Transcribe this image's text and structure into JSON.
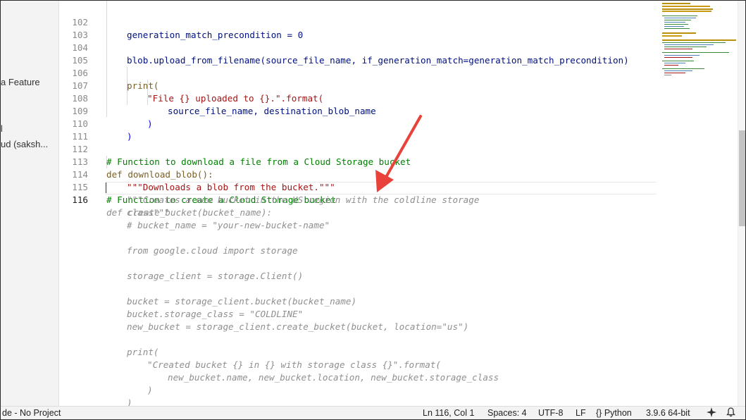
{
  "sidebar": {
    "items": [
      {
        "label": "a Feature"
      },
      {
        "label": "l"
      },
      {
        "label": "ud (saksh..."
      }
    ]
  },
  "editor": {
    "lines": [
      {
        "num": "102",
        "code": "generation_match_precondition = 0"
      },
      {
        "num": "103",
        "code": ""
      },
      {
        "num": "104",
        "code": "blob.upload_from_filename(source_file_name, if_generation_match=generation_match_precondition)"
      },
      {
        "num": "105",
        "code": ""
      },
      {
        "num": "106",
        "code": "print("
      },
      {
        "num": "107",
        "code": "\"File {} uploaded to {}.\".format("
      },
      {
        "num": "108",
        "code": "source_file_name, destination_blob_name"
      },
      {
        "num": "109",
        "code": ")"
      },
      {
        "num": "110",
        "code": ")"
      },
      {
        "num": "111",
        "code": ""
      },
      {
        "num": "112",
        "code": "# Function to download a file from a Cloud Storage bucket"
      },
      {
        "num": "113",
        "code": "def download_blob():"
      },
      {
        "num": "114",
        "code": "\"\"\"Downloads a blob from the bucket.\"\"\""
      },
      {
        "num": "115",
        "code": "# Function to create a Cloud Storage bucket"
      },
      {
        "num": "116",
        "code": "def create_bucket(bucket_name):"
      }
    ],
    "suggestion_lines": [
      "\"\"\"Creates a new bucket in the US region with the coldline storage",
      "class\"\"\"",
      "# bucket_name = \"your-new-bucket-name\"",
      "",
      "from google.cloud import storage",
      "",
      "storage_client = storage.Client()",
      "",
      "bucket = storage_client.bucket(bucket_name)",
      "bucket.storage_class = \"COLDLINE\"",
      "new_bucket = storage_client.create_bucket(bucket, location=\"us\")",
      "",
      "print(",
      "\"Created bucket {} in {} with storage class {}\".format(",
      "new_bucket.name, new_bucket.location, new_bucket.storage_class",
      ")",
      ")"
    ]
  },
  "colors": {
    "keyword": "#0000ff",
    "function": "#795e26",
    "variable": "#001080",
    "string": "#a31515",
    "comment": "#008000",
    "ghost_text": "#8f8f8f",
    "annotation_arrow": "#e8423a"
  },
  "annotation": {
    "icon": "red-arrow-icon"
  },
  "status_bar": {
    "left_text": "de - No Project",
    "cursor_position": "Ln 116, Col 1",
    "indentation": "Spaces: 4",
    "encoding": "UTF-8",
    "line_ending": "LF",
    "language": "Python",
    "language_icon": "braces-icon",
    "interpreter": "3.9.6 64-bit",
    "copilot_icon": "sparkle-icon",
    "notifications_icon": "bell-icon"
  }
}
